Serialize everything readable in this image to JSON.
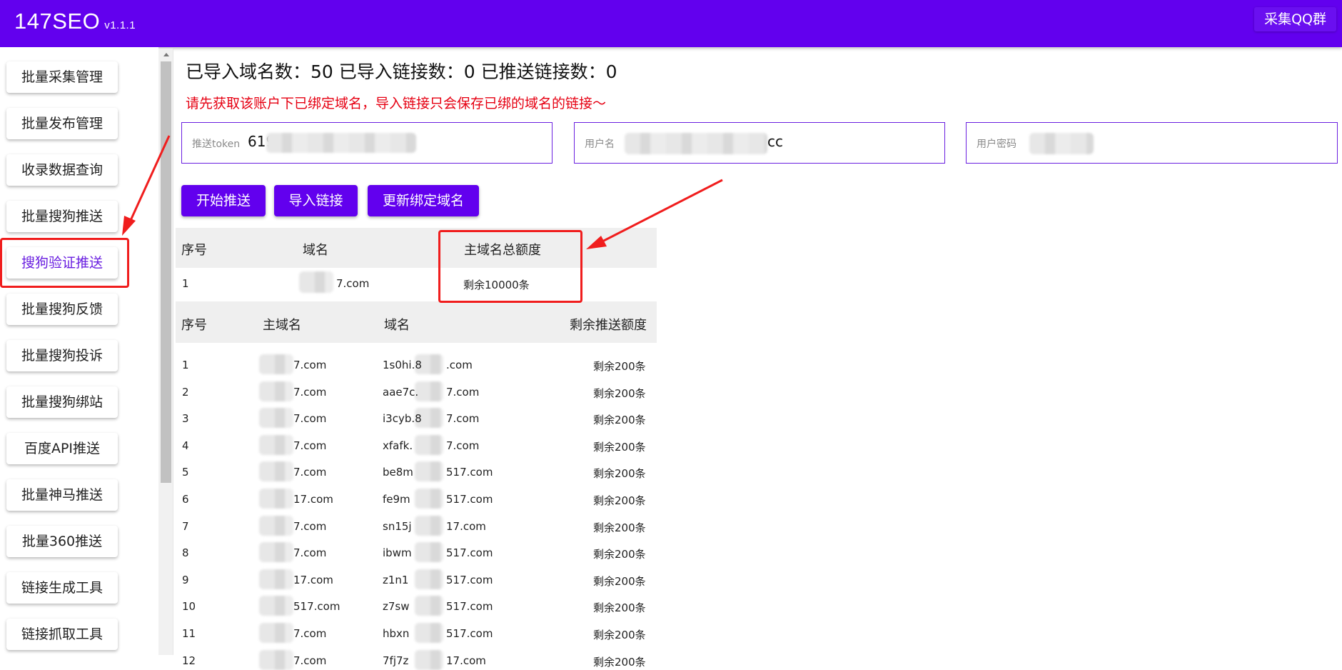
{
  "header": {
    "brand": "147SEO",
    "version": "v1.1.1",
    "qq_button": "采集QQ群"
  },
  "sidebar": {
    "items": [
      {
        "label": "批量采集管理",
        "active": false
      },
      {
        "label": "批量发布管理",
        "active": false
      },
      {
        "label": "收录数据查询",
        "active": false
      },
      {
        "label": "批量搜狗推送",
        "active": false
      },
      {
        "label": "搜狗验证推送",
        "active": true
      },
      {
        "label": "批量搜狗反馈",
        "active": false
      },
      {
        "label": "批量搜狗投诉",
        "active": false
      },
      {
        "label": "批量搜狗绑站",
        "active": false
      },
      {
        "label": "百度API推送",
        "active": false
      },
      {
        "label": "批量神马推送",
        "active": false
      },
      {
        "label": "批量360推送",
        "active": false
      },
      {
        "label": "链接生成工具",
        "active": false
      },
      {
        "label": "链接抓取工具",
        "active": false
      }
    ]
  },
  "main": {
    "stats": "已导入域名数：50 已导入链接数：0 已推送链接数：0",
    "warning": "请先获取该账户下已绑定域名，导入链接只会保存已绑的域名的链接～",
    "fields": {
      "token": {
        "label": "推送token",
        "value": "619"
      },
      "username": {
        "label": "用户名",
        "value": "cc"
      },
      "password": {
        "label": "用户密码",
        "value": ""
      }
    },
    "buttons": {
      "start": "开始推送",
      "import": "导入链接",
      "update": "更新绑定域名"
    },
    "domain_table": {
      "headers": [
        "序号",
        "域名",
        "主域名总额度"
      ],
      "rows": [
        {
          "index": "1",
          "domain": "7.com",
          "quota": "剩余10000条"
        }
      ]
    },
    "sub_table": {
      "headers": [
        "序号",
        "主域名",
        "域名",
        "剩余推送额度"
      ],
      "rows": [
        {
          "index": "1",
          "main": "7.com",
          "domain": "1s0hi.8",
          "domain_tail": ".com",
          "quota": "剩余200条"
        },
        {
          "index": "2",
          "main": "7.com",
          "domain": "aae7c.",
          "domain_tail": "7.com",
          "quota": "剩余200条"
        },
        {
          "index": "3",
          "main": "7.com",
          "domain": "i3cyb.8",
          "domain_tail": "7.com",
          "quota": "剩余200条"
        },
        {
          "index": "4",
          "main": "7.com",
          "domain": "xfafk.",
          "domain_tail": "7.com",
          "quota": "剩余200条"
        },
        {
          "index": "5",
          "main": "7.com",
          "domain": "be8m",
          "domain_tail": "517.com",
          "quota": "剩余200条"
        },
        {
          "index": "6",
          "main": "17.com",
          "domain": "fe9m",
          "domain_tail": "517.com",
          "quota": "剩余200条"
        },
        {
          "index": "7",
          "main": "7.com",
          "domain": "sn15j",
          "domain_tail": "17.com",
          "quota": "剩余200条"
        },
        {
          "index": "8",
          "main": "7.com",
          "domain": "ibwm",
          "domain_tail": "517.com",
          "quota": "剩余200条"
        },
        {
          "index": "9",
          "main": "17.com",
          "domain": "z1n1",
          "domain_tail": "517.com",
          "quota": "剩余200条"
        },
        {
          "index": "10",
          "main": "517.com",
          "domain": "z7sw",
          "domain_tail": "517.com",
          "quota": "剩余200条"
        },
        {
          "index": "11",
          "main": "7.com",
          "domain": "hbxn",
          "domain_tail": "517.com",
          "quota": "剩余200条"
        },
        {
          "index": "12",
          "main": "7.com",
          "domain": "7fj7z",
          "domain_tail": "17.com",
          "quota": "剩余200条"
        }
      ]
    }
  },
  "colors": {
    "primary": "#6200ee",
    "warning": "#e60012",
    "annotation": "#f01d1d"
  }
}
